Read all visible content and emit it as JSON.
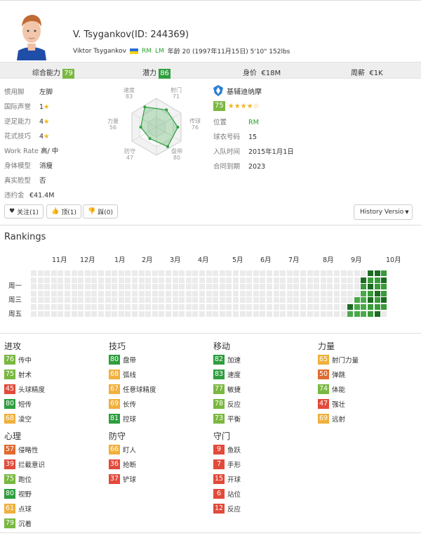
{
  "player": {
    "name_line": "V. Tsygankov(ID: 244369)",
    "full_name": "Viktor Tsygankov",
    "pos1": "RM",
    "pos2": "LM",
    "details": "年龄 20 (1997年11月15日) 5'10\" 152lbs"
  },
  "stats": {
    "overall_label": "综合能力",
    "overall": "79",
    "potential_label": "潜力",
    "potential": "86",
    "value_label": "身价",
    "value": "€18M",
    "wage_label": "周薪",
    "wage": "€1K"
  },
  "info": [
    {
      "k": "惯用脚",
      "v": "左脚",
      "stars": ""
    },
    {
      "k": "国际声誉",
      "v": "1",
      "stars": "★"
    },
    {
      "k": "逆足能力",
      "v": "4",
      "stars": "★"
    },
    {
      "k": "花式技巧",
      "v": "4",
      "stars": "★"
    },
    {
      "k": "Work Rate",
      "v": "高/ 中",
      "stars": ""
    },
    {
      "k": "身体模型",
      "v": "消瘦",
      "stars": ""
    },
    {
      "k": "真实脸型",
      "v": "否",
      "stars": ""
    },
    {
      "k": "违约金",
      "v": "€41.4M",
      "stars": ""
    }
  ],
  "radar": {
    "speed": {
      "label": "速度",
      "value": "83"
    },
    "shooting": {
      "label": "射门",
      "value": "71"
    },
    "passing": {
      "label": "传球",
      "value": "76"
    },
    "dribbling": {
      "label": "盘带",
      "value": "80"
    },
    "defending": {
      "label": "防守",
      "value": "47"
    },
    "physical": {
      "label": "力量",
      "value": "56"
    }
  },
  "club": {
    "name": "基辅迪纳摩",
    "rating": "75",
    "stars": "★★★★",
    "empty_star": "☆",
    "rows": [
      {
        "k": "位置",
        "v": "RM",
        "green": true
      },
      {
        "k": "球衣号码",
        "v": "15",
        "green": false
      },
      {
        "k": "入队时间",
        "v": "2015年1月1日",
        "green": false
      },
      {
        "k": "合同到期",
        "v": "2023",
        "green": false
      }
    ]
  },
  "buttons": {
    "follow": "关注(1)",
    "up": "顶(1)",
    "down": "踩(0)",
    "history": "History Versio"
  },
  "rankings": {
    "title": "Rankings",
    "months": [
      "11月",
      "12月",
      "1月",
      "2月",
      "3月",
      "4月",
      "5月",
      "6月",
      "7月",
      "8月",
      "9月",
      "10月"
    ],
    "days": [
      "周一",
      "周三",
      "周五"
    ]
  },
  "attributes": {
    "attack": {
      "title": "进攻",
      "items": [
        {
          "v": "76",
          "n": "传中"
        },
        {
          "v": "75",
          "n": "射术"
        },
        {
          "v": "45",
          "n": "头球精度"
        },
        {
          "v": "80",
          "n": "短传"
        },
        {
          "v": "68",
          "n": "凌空"
        }
      ]
    },
    "skill": {
      "title": "技巧",
      "items": [
        {
          "v": "80",
          "n": "盘带"
        },
        {
          "v": "68",
          "n": "弧线"
        },
        {
          "v": "67",
          "n": "任意球精度"
        },
        {
          "v": "69",
          "n": "长传"
        },
        {
          "v": "81",
          "n": "控球"
        }
      ]
    },
    "movement": {
      "title": "移动",
      "items": [
        {
          "v": "82",
          "n": "加速"
        },
        {
          "v": "83",
          "n": "速度"
        },
        {
          "v": "77",
          "n": "敏捷"
        },
        {
          "v": "78",
          "n": "反应"
        },
        {
          "v": "73",
          "n": "平衡"
        }
      ]
    },
    "power": {
      "title": "力量",
      "items": [
        {
          "v": "65",
          "n": "射门力量"
        },
        {
          "v": "50",
          "n": "弹跳"
        },
        {
          "v": "74",
          "n": "体能"
        },
        {
          "v": "47",
          "n": "强壮"
        },
        {
          "v": "69",
          "n": "远射"
        }
      ]
    },
    "mental": {
      "title": "心理",
      "items": [
        {
          "v": "57",
          "n": "侵略性"
        },
        {
          "v": "39",
          "n": "拦截意识"
        },
        {
          "v": "75",
          "n": "跑位"
        },
        {
          "v": "80",
          "n": "视野"
        },
        {
          "v": "61",
          "n": "点球"
        },
        {
          "v": "79",
          "n": "沉着"
        }
      ]
    },
    "defence": {
      "title": "防守",
      "items": [
        {
          "v": "66",
          "n": "盯人"
        },
        {
          "v": "36",
          "n": "抢断"
        },
        {
          "v": "37",
          "n": "铲球"
        }
      ]
    },
    "goalkeeping": {
      "title": "守门",
      "items": [
        {
          "v": "9",
          "n": "鱼跃"
        },
        {
          "v": "7",
          "n": "手形"
        },
        {
          "v": "15",
          "n": "开球"
        },
        {
          "v": "6",
          "n": "站位"
        },
        {
          "v": "12",
          "n": "反应"
        }
      ]
    }
  }
}
